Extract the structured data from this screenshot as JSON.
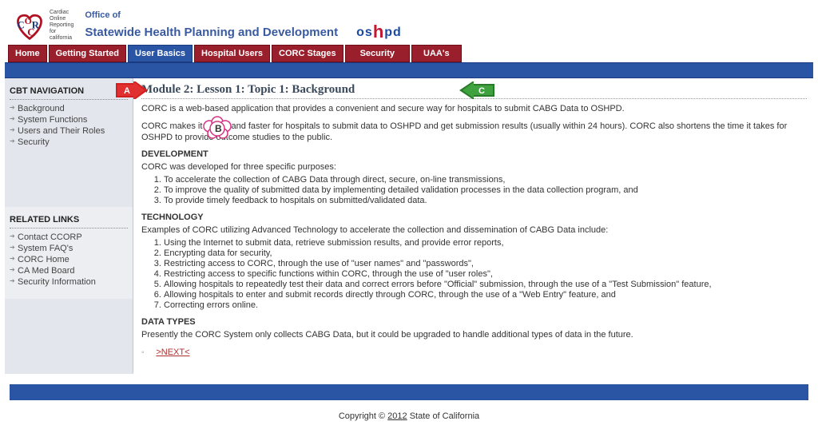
{
  "header": {
    "logo_sub": "Cardiac\nOnline\nReporting\nfor\ncalifornia",
    "office_l1": "Office of",
    "office_l2": "Statewide Health Planning and Development",
    "oshpd_pre": "os",
    "oshpd_h": "h",
    "oshpd_post": "pd"
  },
  "tabs": [
    "Home",
    "Getting Started",
    "User Basics",
    "Hospital Users",
    "CORC Stages",
    "Security",
    "UAA's"
  ],
  "labels": {
    "A": "A",
    "B": "B",
    "C": "C"
  },
  "side": {
    "nav_title": "CBT NAVIGATION",
    "nav_items": [
      "Background",
      "System Functions",
      "Users and Their Roles",
      "Security"
    ],
    "rel_title": "RELATED LINKS",
    "rel_items": [
      "Contact CCORP",
      "System FAQ's",
      "CORC Home",
      "CA Med Board",
      "Security Information"
    ]
  },
  "content": {
    "title": "Module 2: Lesson 1: Topic 1: Background",
    "p1": "CORC is a web-based application that provides a convenient and secure way for hospitals to submit CABG Data to OSHPD.",
    "p2": "CORC makes it easier and faster for hospitals to submit data to OSHPD and get submission results (usually within 24 hours). CORC also shortens the time it takes for OSHPD to provide outcome studies to the public.",
    "h_dev": "DEVELOPMENT",
    "p_dev": "CORC was developed for three specific purposes:",
    "ol_dev": [
      "To accelerate the collection of CABG Data through direct, secure, on-line transmissions,",
      "To improve the quality of submitted data by implementing detailed validation processes in the data collection program, and",
      "To provide timely feedback to hospitals on submitted/validated data."
    ],
    "h_tech": "TECHNOLOGY",
    "p_tech": "Examples of CORC utilizing Advanced Technology to accelerate the collection and dissemination of CABG Data include:",
    "ol_tech": [
      "Using the Internet to submit data, retrieve submission results, and provide error reports,",
      "Encrypting data for security,",
      "Restricting access to CORC, through the use of \"user names\" and \"passwords\",",
      "Restricting access to specific functions within CORC, through the use of \"user roles\",",
      "Allowing hospitals to repeatedly test their data and correct errors before \"Official\" submission, through the use of a \"Test Submission\" feature,",
      "Allowing hospitals to enter and submit records directly through CORC, through the use of a \"Web Entry\" feature, and",
      "Correcting errors online."
    ],
    "h_data": "DATA TYPES",
    "p_data": "Presently the CORC System only collects CABG Data, but it could be upgraded to handle additional types of data in the future.",
    "next": ">NEXT<"
  },
  "footer": {
    "copy_pre": "Copyright © ",
    "year": "2012",
    "copy_post": " State of California"
  }
}
